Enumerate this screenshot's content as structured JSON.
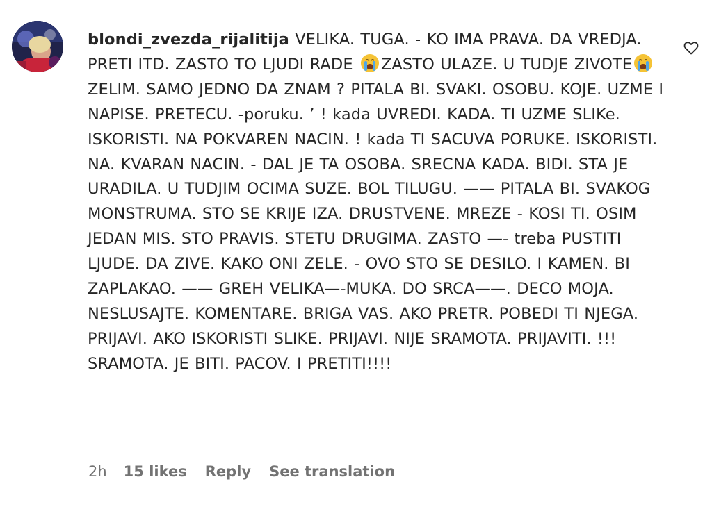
{
  "comment": {
    "username": "blondi_zvezda_rijalitija",
    "text_parts": [
      "VELIKA. TUGA. - KO IMA PRAVA. DA VREDJA. PRETI ITD. ZASTO TO LJUDI RADE ",
      "ZASTO ULAZE. U TUDJE ZIVOTE",
      " ZELIM. SAMO JEDNO DA ZNAM ? PITALA BI. SVAKI. OSOBU. KOJE. UZME I NAPISE. PRETECU. -poruku. ’ ! kada UVREDI. KADA. TI UZME SLIKe. ISKORISTI. NA POKVAREN NACIN. ! kada TI SACUVA PORUKE. ISKORISTI. NA. KVARAN NACIN. - DAL JE TA OSOBA. SRECNA KADA. BIDI. STA JE URADILA. U TUDJIM OCIMA SUZE. BOL TILUGU. —— PITALA BI. SVAKOG MONSTRUMA. STO SE KRIJE IZA. DRUSTVENE. MREZE - KOSI TI. OSIM JEDAN MIS. STO PRAVIS. STETU DRUGIMA. ZASTO —- treba PUSTITI LJUDE. DA ZIVE. KAKO ONI ZELE. - OVO STO SE DESILO. I KAMEN. BI ZAPLAKAO. —— GREH VELIKA—-MUKA. DO SRCA——. DECO MOJA. NESLUSAJTE. KOMENTARE. BRIGA VAS. AKO PRETR. POBEDI TI NJEGA. PRIJAVI. AKO ISKORISTI SLIKE. PRIJAVI. NIJE SRAMOTA. PRIJAVITI. !!! SRAMOTA. JE BITI. PACOV. I PRETITI!!!!"
    ],
    "emoji_icon": "loudly-crying-face-emoji",
    "time": "2h",
    "likes": "15 likes",
    "reply_label": "Reply",
    "translate_label": "See translation",
    "like_icon": "heart-outline-icon"
  },
  "colors": {
    "text": "#262626",
    "meta": "#737373"
  }
}
